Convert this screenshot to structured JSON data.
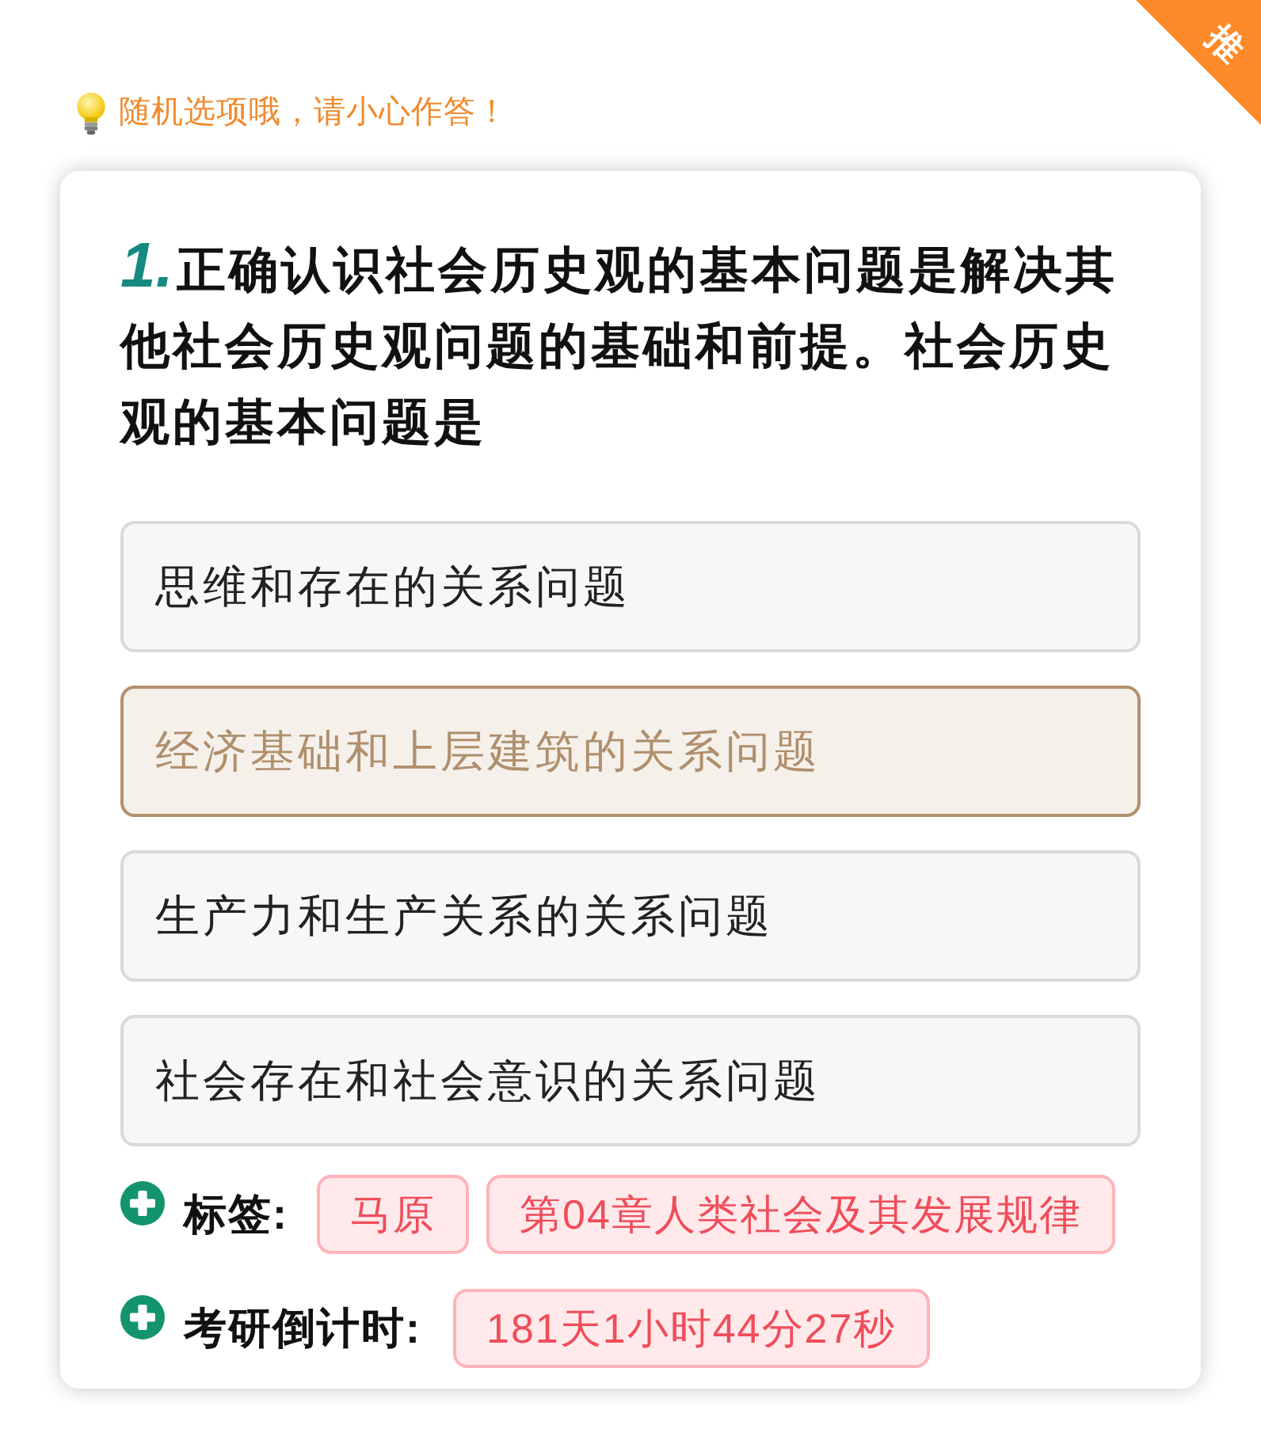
{
  "corner_ribbon": {
    "text": "推"
  },
  "hint": {
    "text": "随机选项哦，请小心作答！"
  },
  "question": {
    "number": "1.",
    "text": "正确认识社会历史观的基本问题是解决其他社会历史观问题的基础和前提。社会历史观的基本问题是"
  },
  "options": [
    {
      "text": "思维和存在的关系问题",
      "selected": false
    },
    {
      "text": "经济基础和上层建筑的关系问题",
      "selected": true
    },
    {
      "text": "生产力和生产关系的关系问题",
      "selected": false
    },
    {
      "text": "社会存在和社会意识的关系问题",
      "selected": false
    }
  ],
  "tags": {
    "label": "标签:",
    "items": [
      "马原",
      "第04章人类社会及其发展规律"
    ]
  },
  "countdown": {
    "label": "考研倒计时:",
    "value": "181天1小时44分27秒"
  }
}
